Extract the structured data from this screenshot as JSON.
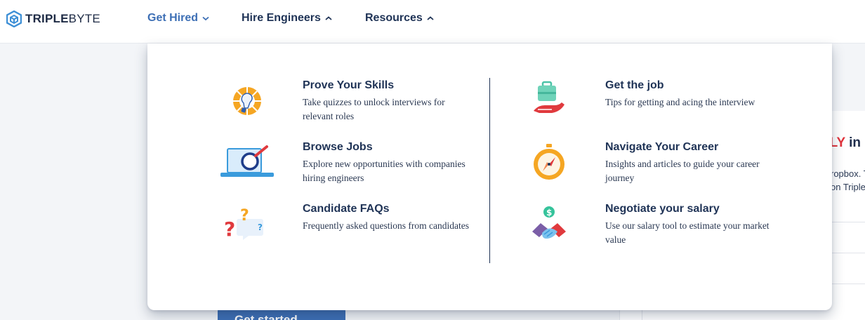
{
  "brand": {
    "bold": "TRIPLE",
    "light": "BYTE"
  },
  "nav": [
    {
      "label": "Get Hired",
      "active": true,
      "chevron": "chevron-down"
    },
    {
      "label": "Hire Engineers",
      "active": false,
      "chevron": "chevron-up"
    },
    {
      "label": "Resources",
      "active": false,
      "chevron": "chevron-up"
    }
  ],
  "dropdown": {
    "left_column": [
      {
        "title": "Prove Your Skills",
        "description": "Take quizzes to unlock interviews for relevant roles",
        "icon": "lightbulb-icon"
      },
      {
        "title": "Browse Jobs",
        "description": "Explore new opportunities with companies hiring engineers",
        "icon": "laptop-magnifier-icon"
      },
      {
        "title": "Candidate FAQs",
        "description": "Frequently asked questions from candidates",
        "icon": "question-marks-icon"
      }
    ],
    "right_column": [
      {
        "title": "Get the job",
        "description": "Tips for getting and acing the interview",
        "icon": "briefcase-hand-icon"
      },
      {
        "title": "Navigate Your Career",
        "description": "Insights and articles to guide your career journey",
        "icon": "compass-icon"
      },
      {
        "title": "Negotiate your salary",
        "description": "Use our salary tool to estimate your market value",
        "icon": "handshake-dollar-icon"
      }
    ]
  },
  "background": {
    "headline_red": "LLY",
    "headline_dark": "in",
    "text_line_1": "ropbox. T",
    "text_line_2": "on Triple",
    "cta_label": "Get started →"
  },
  "colors": {
    "accent_blue": "#3d6fb5",
    "navy": "#1f3356",
    "headline_red": "#e2343c"
  }
}
